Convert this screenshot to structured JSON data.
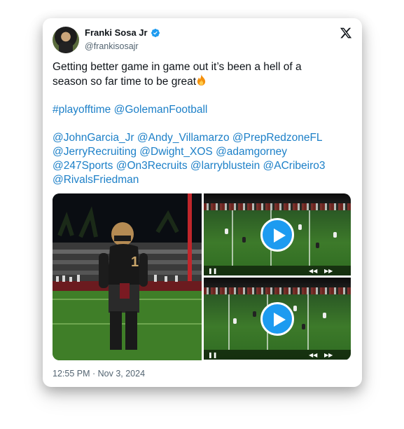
{
  "author": {
    "display_name": "Franki Sosa Jr",
    "handle": "@frankisosajr",
    "verified": true
  },
  "tweet": {
    "line1": "Getting better game in game out it’s been a hell of a",
    "line2": "season so far time to be great",
    "tags": [
      "#playofftime",
      "@GolemanFootball"
    ],
    "mentions_line1": [
      "@JohnGarcia_Jr",
      "@Andy_Villamarzo",
      "@PrepRedzoneFL"
    ],
    "mentions_line2": [
      "@JerryRecruiting",
      "@Dwight_XOS",
      "@adamgorney"
    ],
    "mentions_line3": [
      "@247Sports",
      "@On3Recruits",
      "@larryblustein",
      "@ACribeiro3"
    ],
    "mentions_line4": [
      "@RivalsFriedman"
    ]
  },
  "media": {
    "photo_icon": "football-player-photo",
    "video_icon": "play-icon"
  },
  "timestamp": "12:55 PM · Nov 3, 2024",
  "icons": [
    "verified-badge-icon",
    "x-logo-icon",
    "fire-emoji-icon",
    "play-icon"
  ],
  "colors": {
    "link": "#1d80c8",
    "verified": "#1d9bf0",
    "play_button": "#1d9bf0",
    "muted_text": "#536471"
  }
}
